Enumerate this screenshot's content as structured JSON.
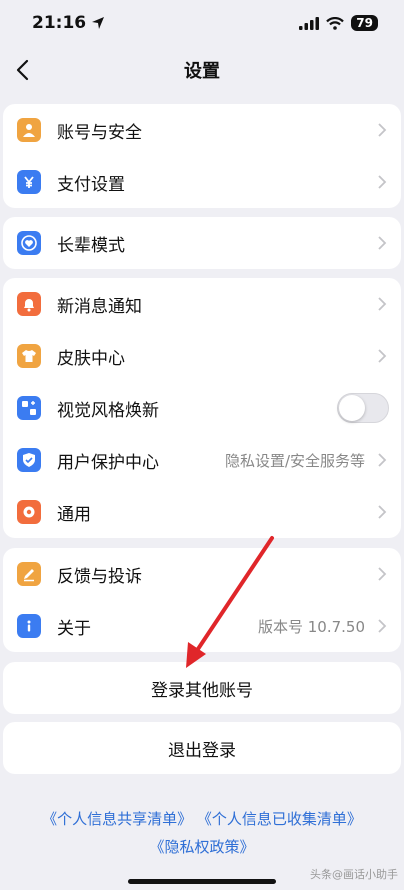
{
  "status_bar": {
    "time": "21:16",
    "battery": "79"
  },
  "nav": {
    "title": "设置"
  },
  "groups": [
    {
      "items": [
        {
          "label": "账号与安全",
          "icon": "person-icon",
          "color": "#f0a441"
        },
        {
          "label": "支付设置",
          "icon": "yen-icon",
          "color": "#3b7cf1"
        }
      ]
    },
    {
      "items": [
        {
          "label": "长辈模式",
          "icon": "heart-badge-icon",
          "color": "#3b7cf1"
        }
      ]
    },
    {
      "items": [
        {
          "label": "新消息通知",
          "icon": "bell-icon",
          "color": "#f26d3d"
        },
        {
          "label": "皮肤中心",
          "icon": "shirt-icon",
          "color": "#f0a441"
        },
        {
          "label": "视觉风格焕新",
          "icon": "new-style-icon",
          "color": "#3b7cf1"
        },
        {
          "label": "用户保护中心",
          "value": "隐私设置/安全服务等",
          "icon": "shield-icon",
          "color": "#3b7cf1"
        },
        {
          "label": "通用",
          "icon": "gear-icon",
          "color": "#f26d3d"
        }
      ]
    },
    {
      "items": [
        {
          "label": "反馈与投诉",
          "icon": "feedback-icon",
          "color": "#f0a441"
        },
        {
          "label": "关于",
          "value": "版本号 10.7.50",
          "icon": "info-icon",
          "color": "#3b7cf1"
        }
      ]
    }
  ],
  "buttons": {
    "switch_account": "登录其他账号",
    "logout": "退出登录"
  },
  "links": {
    "shared_list": "《个人信息共享清单》",
    "collected_list": "《个人信息已收集清单》",
    "privacy_policy": "《隐私权政策》"
  },
  "watermark": "头条@画话小助手",
  "colors": {
    "link": "#2f6fd6",
    "arrow": "#e0262a",
    "background": "#efeff4"
  }
}
